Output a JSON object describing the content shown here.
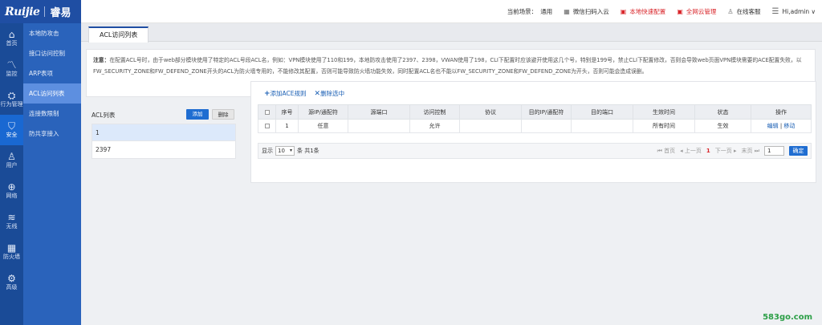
{
  "brand": {
    "logo_text": "Ruijie",
    "cn_text": "睿易"
  },
  "topbar": {
    "scene_label": "当前场景：",
    "scene_value": "通用",
    "wechat_label": "微信扫码入云",
    "quick_config": "本地快速配置",
    "cloud_manage": "全网云管理",
    "online_service": "在线客服",
    "user_label": "Hi,admin ∨"
  },
  "rail": {
    "items": [
      {
        "label": "首页",
        "icon": "home-icon",
        "glyph": "⌂"
      },
      {
        "label": "监控",
        "icon": "chart-line-icon",
        "glyph": "📈"
      },
      {
        "label": "行为管理",
        "icon": "behavior-icon",
        "glyph": "⛭"
      },
      {
        "label": "安全",
        "icon": "shield-icon",
        "glyph": "🛡"
      },
      {
        "label": "用户",
        "icon": "user-icon",
        "glyph": "👤"
      },
      {
        "label": "网络",
        "icon": "network-icon",
        "glyph": "⊕"
      },
      {
        "label": "无线",
        "icon": "wifi-icon",
        "glyph": "≋"
      },
      {
        "label": "防火墙",
        "icon": "firewall-icon",
        "glyph": "▦"
      },
      {
        "label": "高级",
        "icon": "gear-icon",
        "glyph": "⚙"
      }
    ]
  },
  "subnav": {
    "items": [
      {
        "label": "本地防攻击"
      },
      {
        "label": "接口访问控制"
      },
      {
        "label": "ARP表项"
      },
      {
        "label": "ACL访问列表"
      },
      {
        "label": "连接数限制"
      },
      {
        "label": "防共享接入"
      }
    ]
  },
  "tab": {
    "label": "ACL访问列表"
  },
  "notice": {
    "prefix": "注意：",
    "line1": "在配置ACL号时，由于web部分模块使用了特定的ACL号段ACL名，例如：VPN模块使用了110和199，本地防攻击使用了2397、2398，VWAN使用了198，CLI下配置时应该避开使用这几个号，特别是199号，禁止CLI下配置修改，否则会导致web页面VPN模块需要的ACE配置失败，以",
    "line2": "FW_SECURITY_ZONE和FW_DEFEND_ZONE开头的ACL为防火墙专用的，不能修改其配置，否则可能导致防火墙功能失效，同时配置ACL名也不能以FW_SECURITY_ZONE和FW_DEFEND_ZONE为开头，否则可能会造成误删。"
  },
  "acl_list": {
    "title": "ACL列表",
    "add_label": "添加",
    "delete_label": "删除",
    "rows": [
      "1",
      "2397"
    ]
  },
  "ace": {
    "add_rule": "添加ACE规则",
    "delete_selected": "删除选中",
    "columns": [
      "序号",
      "源IP/通配符",
      "源端口",
      "访问控制",
      "协议",
      "目的IP/通配符",
      "目的端口",
      "生效时间",
      "状态",
      "操作"
    ],
    "rows": [
      {
        "seq": "1",
        "src_ip": "任意",
        "src_port": "",
        "action": "允许",
        "protocol": "",
        "dst_ip": "",
        "dst_port": "",
        "time": "所有时间",
        "status": "生效",
        "edit": "编辑",
        "sep": " | ",
        "move": "移动"
      }
    ],
    "pager": {
      "show_label": "显示",
      "page_size": "10",
      "summary": "条 共1条",
      "first": "首页",
      "prev": "上一页",
      "current": "1",
      "next": "下一页",
      "last": "末页",
      "jump_value": "1",
      "confirm": "确定"
    }
  },
  "watermark": "583go.com"
}
